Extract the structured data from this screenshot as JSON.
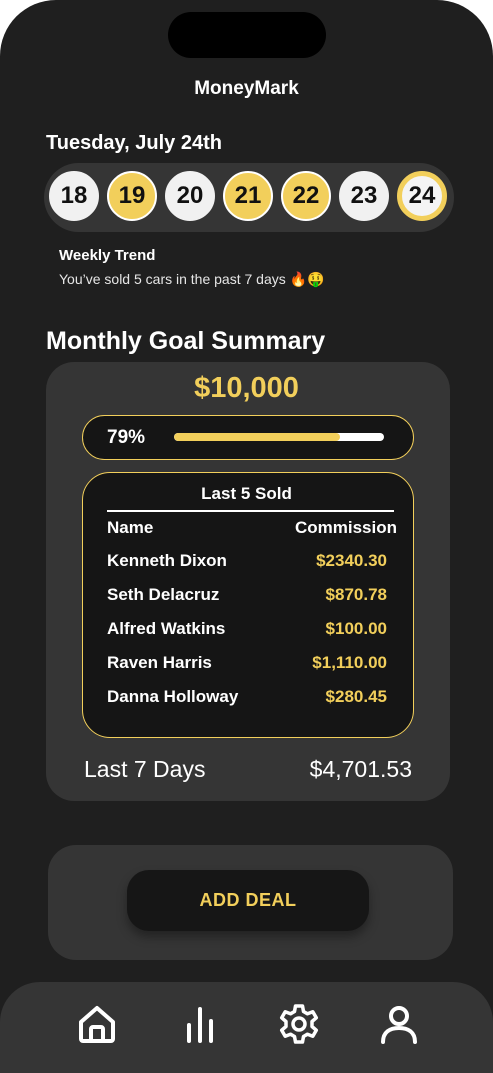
{
  "app": {
    "title": "MoneyMark"
  },
  "date_label": "Tuesday, July 24th",
  "days": [
    {
      "num": "18",
      "state": "plain"
    },
    {
      "num": "19",
      "state": "goal"
    },
    {
      "num": "20",
      "state": "plain"
    },
    {
      "num": "21",
      "state": "goal"
    },
    {
      "num": "22",
      "state": "goal"
    },
    {
      "num": "23",
      "state": "plain"
    },
    {
      "num": "24",
      "state": "today"
    }
  ],
  "trend": {
    "title": "Weekly Trend",
    "text": "You’ve sold 5 cars in the past 7 days 🔥🤑"
  },
  "monthly": {
    "section_title": "Monthly Goal Summary",
    "goal_amount": "$10,000",
    "progress_label": "79%",
    "progress_value": 0.79,
    "last_sold": {
      "title": "Last 5 Sold",
      "col_name": "Name",
      "col_commission": "Commission",
      "rows": [
        {
          "name": "Kenneth Dixon",
          "amount": "$2340.30"
        },
        {
          "name": "Seth Delacruz",
          "amount": "$870.78"
        },
        {
          "name": "Alfred Watkins",
          "amount": "$100.00"
        },
        {
          "name": "Raven Harris",
          "amount": "$1,110.00"
        },
        {
          "name": "Danna Holloway",
          "amount": "$280.45"
        }
      ]
    },
    "last7_label": "Last 7 Days",
    "last7_value": "$4,701.53"
  },
  "actions": {
    "add_deal_label": "ADD DEAL"
  },
  "tabbar": {
    "items": [
      {
        "icon": "home-icon"
      },
      {
        "icon": "bar-chart-icon"
      },
      {
        "icon": "gear-icon"
      },
      {
        "icon": "user-icon"
      }
    ]
  },
  "colors": {
    "accent": "#f2cf5b",
    "background": "#1f1f1f",
    "card": "#353535"
  }
}
